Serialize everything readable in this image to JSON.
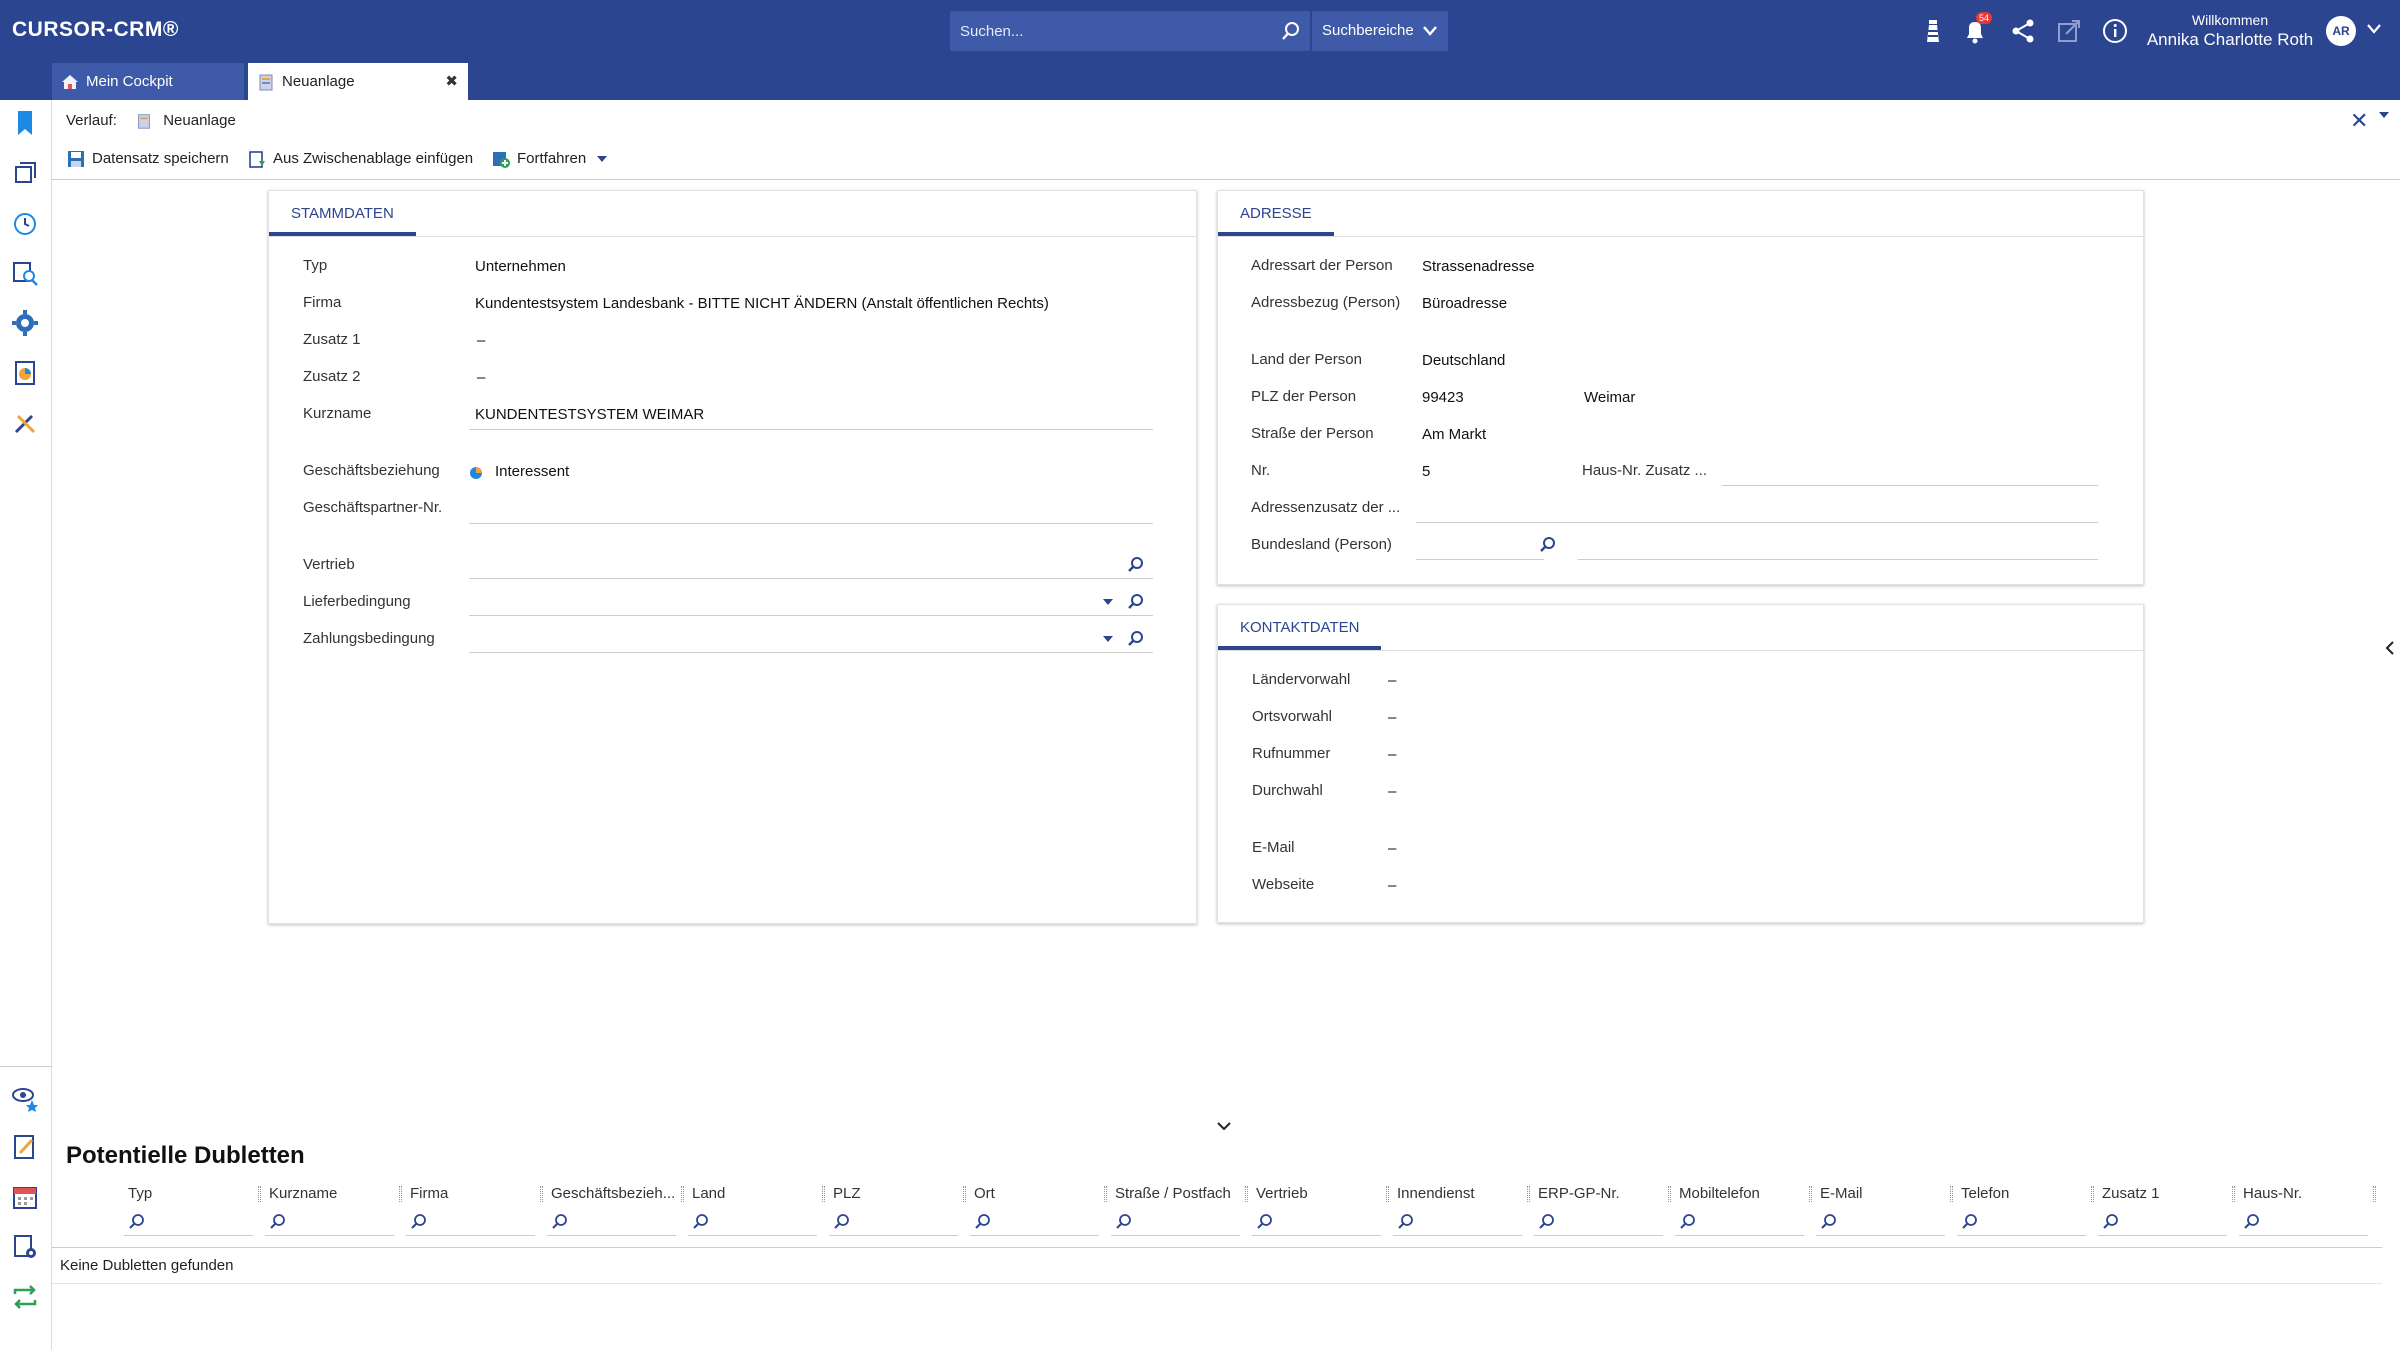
{
  "app": {
    "logo": "CURSOR-CRM®",
    "search_placeholder": "Suchen...",
    "search_areas": "Suchbereiche",
    "notifications_count": "54",
    "welcome": "Willkommen",
    "user_name": "Annika Charlotte Roth",
    "user_initials": "AR"
  },
  "tabs": [
    {
      "label": "Mein Cockpit",
      "active": false
    },
    {
      "label": "Neuanlage",
      "active": true
    }
  ],
  "breadcrumb": {
    "label": "Verlauf:",
    "item": "Neuanlage"
  },
  "toolbar": {
    "save": "Datensatz speichern",
    "paste": "Aus Zwischenablage einfügen",
    "continue": "Fortfahren"
  },
  "stammdaten": {
    "title": "STAMMDATEN",
    "fields": {
      "typ": {
        "label": "Typ",
        "value": "Unternehmen"
      },
      "firma": {
        "label": "Firma",
        "value": "Kundentestsystem Landesbank - BITTE NICHT ÄNDERN (Anstalt öffentlichen Rechts)"
      },
      "zusatz1": {
        "label": "Zusatz 1",
        "value": "–"
      },
      "zusatz2": {
        "label": "Zusatz 2",
        "value": "–"
      },
      "kurzname": {
        "label": "Kurzname",
        "value": "KUNDENTESTSYSTEM WEIMAR"
      },
      "geschaeftsbeziehung": {
        "label": "Geschäftsbeziehung",
        "value": "Interessent"
      },
      "partnernr": {
        "label": "Geschäftspartner-Nr.",
        "value": ""
      },
      "vertrieb": {
        "label": "Vertrieb",
        "value": ""
      },
      "lieferbedingung": {
        "label": "Lieferbedingung",
        "value": ""
      },
      "zahlungsbedingung": {
        "label": "Zahlungsbedingung",
        "value": ""
      }
    }
  },
  "adresse": {
    "title": "ADRESSE",
    "fields": {
      "adressart": {
        "label": "Adressart der Person",
        "value": "Strassenadresse"
      },
      "adressbezug": {
        "label": "Adressbezug (Person)",
        "value": "Büroadresse"
      },
      "land": {
        "label": "Land der Person",
        "value": "Deutschland"
      },
      "plz": {
        "label": "PLZ der Person",
        "value": "99423"
      },
      "ort": {
        "value": "Weimar"
      },
      "strasse": {
        "label": "Straße der Person",
        "value": "Am Markt"
      },
      "nr": {
        "label": "Nr.",
        "value": "5"
      },
      "hausnr_zusatz": {
        "label": "Haus-Nr. Zusatz ...",
        "value": ""
      },
      "adresszusatz": {
        "label": "Adressenzusatz der ...",
        "value": ""
      },
      "bundesland": {
        "label": "Bundesland (Person)",
        "value": ""
      }
    }
  },
  "kontakt": {
    "title": "KONTAKTDATEN",
    "fields": {
      "laendervorwahl": {
        "label": "Ländervorwahl",
        "value": "–"
      },
      "ortsvorwahl": {
        "label": "Ortsvorwahl",
        "value": "–"
      },
      "rufnummer": {
        "label": "Rufnummer",
        "value": "–"
      },
      "durchwahl": {
        "label": "Durchwahl",
        "value": "–"
      },
      "email": {
        "label": "E-Mail",
        "value": "–"
      },
      "webseite": {
        "label": "Webseite",
        "value": "–"
      }
    }
  },
  "dupes": {
    "title": "Potentielle Dubletten",
    "columns": [
      "Typ",
      "Kurzname",
      "Firma",
      "Geschäftsbezieh...",
      "Land",
      "PLZ",
      "Ort",
      "Straße / Postfach",
      "Vertrieb",
      "Innendienst",
      "ERP-GP-Nr.",
      "Mobiltelefon",
      "E-Mail",
      "Telefon",
      "Zusatz 1",
      "Haus-Nr."
    ],
    "empty": "Keine Dubletten gefunden"
  },
  "colors": {
    "brand": "#2b4591",
    "brand_light": "#3e5aa8",
    "badge": "#e53935"
  }
}
